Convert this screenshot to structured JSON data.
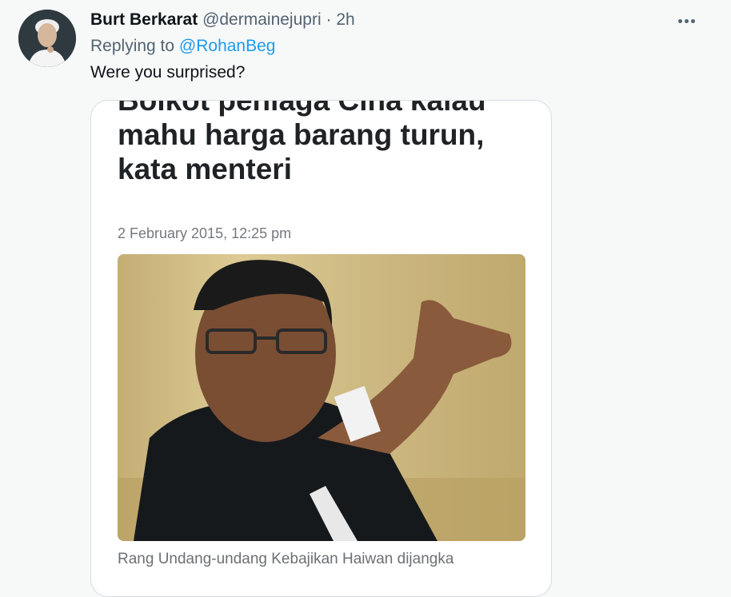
{
  "tweet": {
    "display_name": "Burt Berkarat",
    "handle": "@dermainejupri",
    "separator": "·",
    "time": "2h",
    "reply_prefix": "Replying to",
    "reply_mention": "@RohanBeg",
    "text": "Were you surprised?"
  },
  "card": {
    "headline_lines": [
      "Boikot peniaga Cina kalau",
      "mahu harga barang turun,",
      "kata menteri"
    ],
    "date": "2 February 2015, 12:25 pm",
    "caption": "Rang Undang-undang Kebajikan Haiwan dijangka"
  },
  "icons": {
    "more": "more-horizontal-icon"
  },
  "colors": {
    "link": "#1d9bf0",
    "muted": "#536471",
    "text": "#0f1419",
    "background": "#f7f8f8"
  }
}
